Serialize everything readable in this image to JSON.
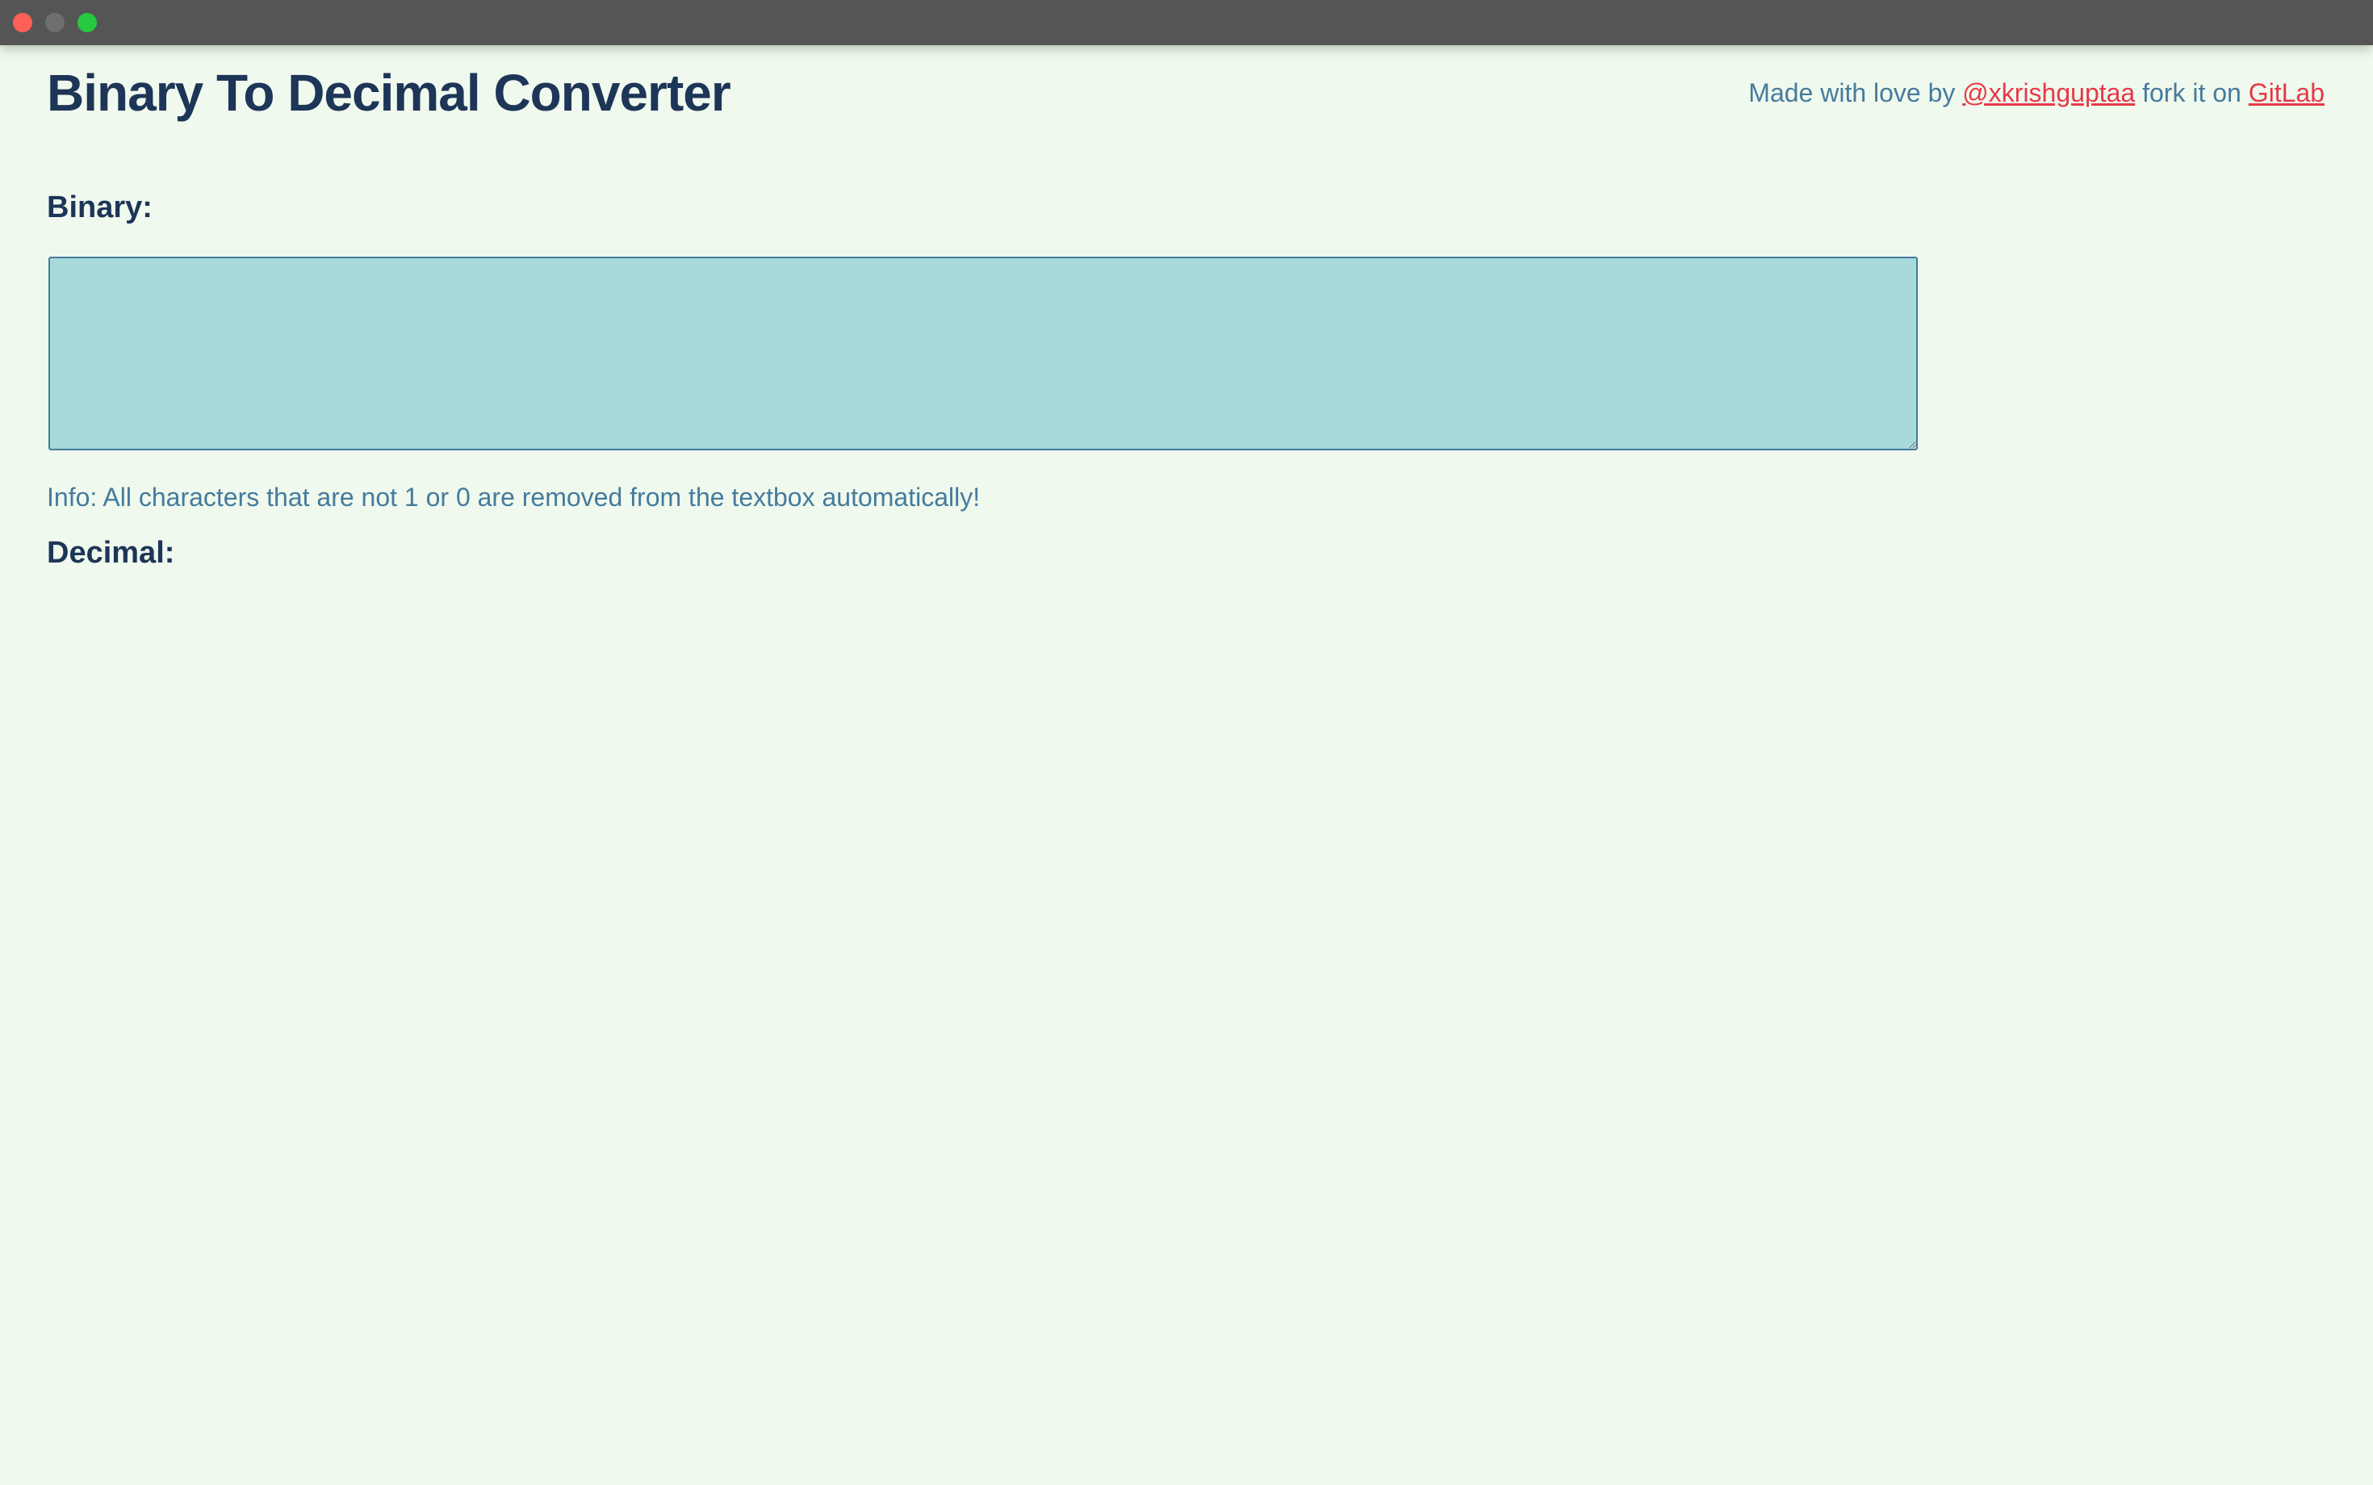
{
  "header": {
    "title": "Binary To Decimal Converter",
    "credit_prefix": "Made with love by",
    "author_link": "@xkrishguptaa",
    "credit_middle": "fork it on",
    "repo_link": "GitLab"
  },
  "binary": {
    "label": "Binary:",
    "value": ""
  },
  "info": "Info: All characters that are not 1 or 0 are removed from the textbox automatically!",
  "decimal": {
    "label": "Decimal:",
    "value": ""
  },
  "colors": {
    "background": "#f0f9ee",
    "heading": "#1d3557",
    "textarea": "#a8dadc",
    "info": "#457b9d",
    "link": "#e63946"
  }
}
